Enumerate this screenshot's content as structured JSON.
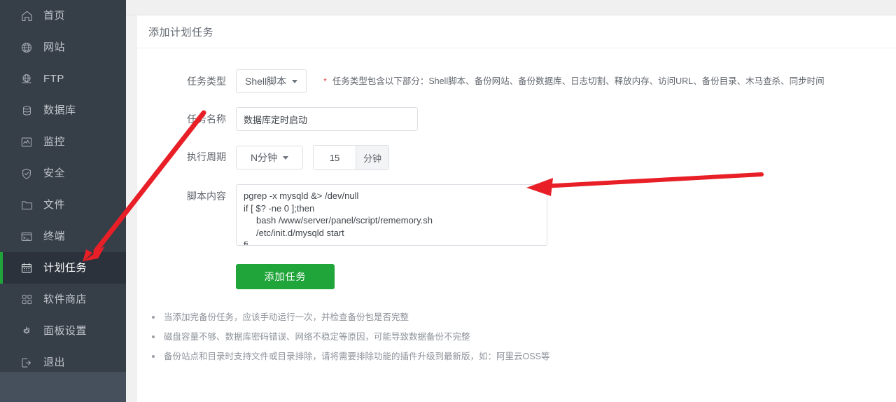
{
  "sidebar": {
    "items": [
      {
        "label": "首页",
        "icon": "home-icon",
        "active": false
      },
      {
        "label": "网站",
        "icon": "globe-icon",
        "active": false
      },
      {
        "label": "FTP",
        "icon": "ftp-icon",
        "active": false
      },
      {
        "label": "数据库",
        "icon": "database-icon",
        "active": false
      },
      {
        "label": "监控",
        "icon": "monitor-icon",
        "active": false
      },
      {
        "label": "安全",
        "icon": "shield-icon",
        "active": false
      },
      {
        "label": "文件",
        "icon": "folder-icon",
        "active": false
      },
      {
        "label": "终端",
        "icon": "terminal-icon",
        "active": false
      },
      {
        "label": "计划任务",
        "icon": "calendar-icon",
        "active": true
      },
      {
        "label": "软件商店",
        "icon": "grid-icon",
        "active": false
      },
      {
        "label": "面板设置",
        "icon": "gear-icon",
        "active": false
      },
      {
        "label": "退出",
        "icon": "logout-icon",
        "active": false
      }
    ]
  },
  "panel": {
    "title": "添加计划任务"
  },
  "form": {
    "task_type": {
      "label": "任务类型",
      "value": "Shell脚本",
      "required_mark": "*",
      "hint": "任务类型包含以下部分：Shell脚本、备份网站、备份数据库、日志切割、释放内存、访问URL、备份目录、木马查杀、同步时间"
    },
    "task_name": {
      "label": "任务名称",
      "value": "数据库定时启动",
      "placeholder": ""
    },
    "cycle": {
      "label": "执行周期",
      "type_value": "N分钟",
      "number_value": "15",
      "unit": "分钟"
    },
    "script": {
      "label": "脚本内容",
      "value": "pgrep -x mysqld &> /dev/null\nif [ $? -ne 0 ];then\n     bash /www/server/panel/script/rememory.sh\n     /etc/init.d/mysqld start\nfi"
    },
    "submit_label": "添加任务"
  },
  "notes": [
    "当添加完备份任务，应该手动运行一次，并检查备份包是否完整",
    "磁盘容量不够、数据库密码错误、网络不稳定等原因，可能导致数据备份不完整",
    "备份站点和目录时支持文件或目录排除，请将需要排除功能的插件升级到最新版，如：阿里云OSS等"
  ],
  "colors": {
    "accent_green": "#20a53a",
    "sidebar_bg": "#363e48",
    "sidebar_active_bg": "#2b323b",
    "annotation_red": "#e81f27"
  }
}
